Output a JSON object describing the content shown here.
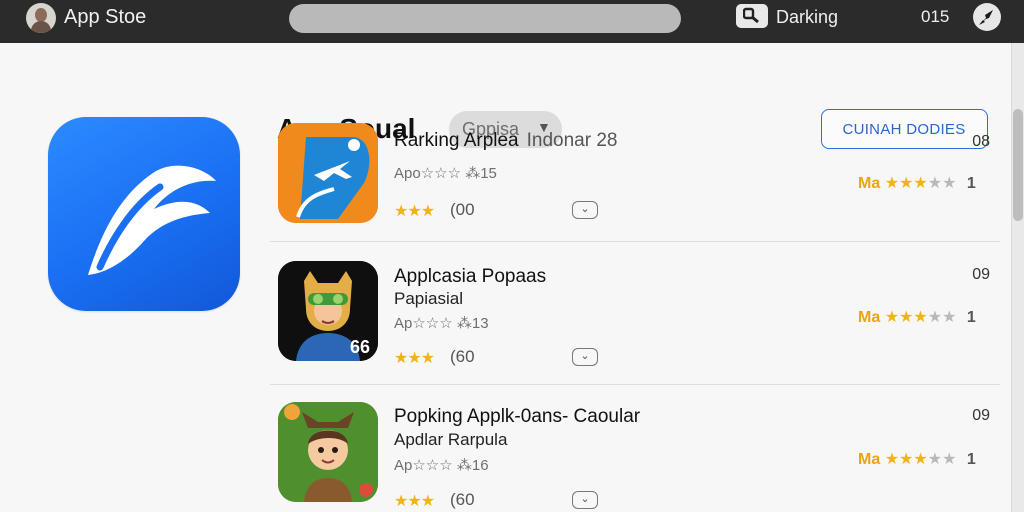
{
  "header": {
    "app_title": "App Stoe",
    "ranking_label": "Darking",
    "time_label": "015"
  },
  "section": {
    "title": "App Soual",
    "dropdown_label": "Gppisa",
    "action_label": "CUINAH DODIES"
  },
  "rows": [
    {
      "name": "Rarking Arplea",
      "name_sub": "Indonar 28",
      "name_line2": "",
      "meta": "Apo☆☆☆ ⁂15",
      "stars": "★★★",
      "count": "(00",
      "chevron": "⌄",
      "rank": "08",
      "rating_label": "Ma",
      "rating_stars_on": "★★★",
      "rating_stars_off": "★★",
      "rating_end": "1"
    },
    {
      "name": "Applcasia Popaas",
      "name_sub": "",
      "name_line2": "Papiasial",
      "meta": "Ap☆☆☆ ⁂13",
      "stars": "★★★",
      "count": "(60",
      "chevron": "⌄",
      "rank": "09",
      "rating_label": "Ma",
      "rating_stars_on": "★★★",
      "rating_stars_off": "★★",
      "rating_end": "1"
    },
    {
      "name": "Popking Applk-0ans- Caoular",
      "name_sub": "",
      "name_line2": "Apdlar Rarpula",
      "meta": "Ap☆☆☆ ⁂16",
      "stars": "★★★",
      "count": "(60",
      "chevron": "⌄",
      "rank": "09",
      "rating_label": "Ma",
      "rating_stars_on": "★★★",
      "rating_stars_off": "★★",
      "rating_end": "1"
    }
  ],
  "icons": {
    "row1_badge": "",
    "row2_badge": "66"
  },
  "colors": {
    "topbar": "#2b2b2b",
    "accent_blue": "#1a6ff2",
    "star_gold": "#f0b417"
  }
}
